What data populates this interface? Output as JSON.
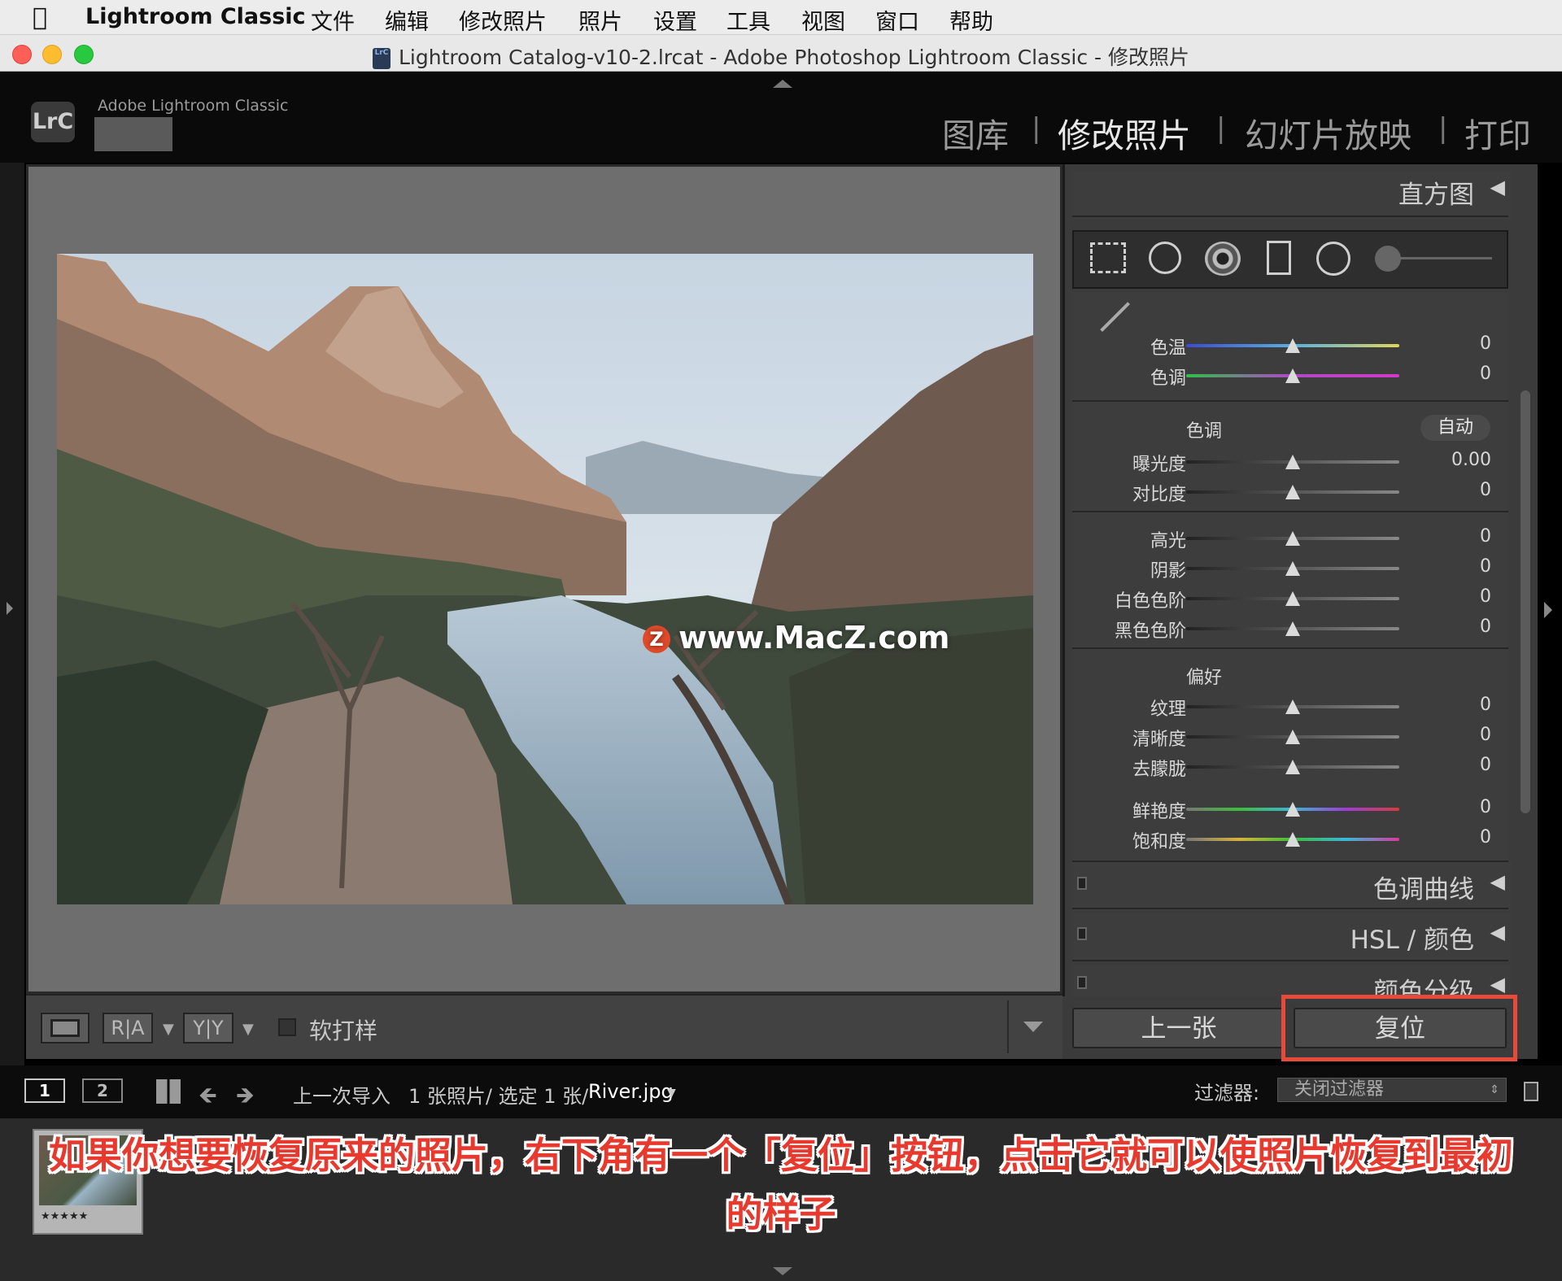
{
  "menubar": {
    "apple_icon": "apple-icon",
    "app_name": "Lightroom Classic",
    "items": [
      "文件",
      "编辑",
      "修改照片",
      "照片",
      "设置",
      "工具",
      "视图",
      "窗口",
      "帮助"
    ]
  },
  "window": {
    "title": "Lightroom Catalog-v10-2.lrcat - Adobe Photoshop Lightroom Classic - 修改照片",
    "doc_badge": "LrC"
  },
  "identity": {
    "logo": "LrC",
    "product": "Adobe Lightroom Classic"
  },
  "modules": {
    "library": "图库",
    "develop": "修改照片",
    "slideshow": "幻灯片放映",
    "print": "打印",
    "separator": "|"
  },
  "watermark": {
    "z": "Z",
    "text": "www.MacZ.com"
  },
  "toolbar": {
    "soft_proof": "软打样",
    "ra_label": "R|A",
    "yy_label": "Y|Y"
  },
  "panels": {
    "histogram": "直方图",
    "collapse_arrow": "◀",
    "tone_curve": "色调曲线",
    "hsl": "HSL / 颜色",
    "color_grading": "颜色分级"
  },
  "basic": {
    "wb_group": [
      {
        "label": "色温",
        "value": "0"
      },
      {
        "label": "色调",
        "value": "0"
      }
    ],
    "tone_header": "色调",
    "auto_label": "自动",
    "tone_group": [
      {
        "label": "曝光度",
        "value": "0.00"
      },
      {
        "label": "对比度",
        "value": "0"
      }
    ],
    "tone_group2": [
      {
        "label": "高光",
        "value": "0"
      },
      {
        "label": "阴影",
        "value": "0"
      },
      {
        "label": "白色色阶",
        "value": "0"
      },
      {
        "label": "黑色色阶",
        "value": "0"
      }
    ],
    "presence_header": "偏好",
    "presence_group": [
      {
        "label": "纹理",
        "value": "0"
      },
      {
        "label": "清晰度",
        "value": "0"
      },
      {
        "label": "去朦胧",
        "value": "0"
      }
    ],
    "color_group": [
      {
        "label": "鲜艳度",
        "value": "0"
      },
      {
        "label": "饱和度",
        "value": "0"
      }
    ]
  },
  "nav": {
    "previous": "上一张",
    "reset": "复位"
  },
  "filmbar": {
    "page1": "1",
    "page2": "2",
    "source": "上一次导入",
    "count": "1 张照片/ 选定 1 张/",
    "filename": "River.jpg",
    "filter_label": "过滤器:",
    "filter_value": "关闭过滤器"
  },
  "thumbnail": {
    "rating": "★★★★★"
  },
  "caption": {
    "line1": "如果你想要恢复原来的照片，右下角有一个「复位」按钮，点击它就可以使照片恢复到最初",
    "line2": "的样子"
  }
}
